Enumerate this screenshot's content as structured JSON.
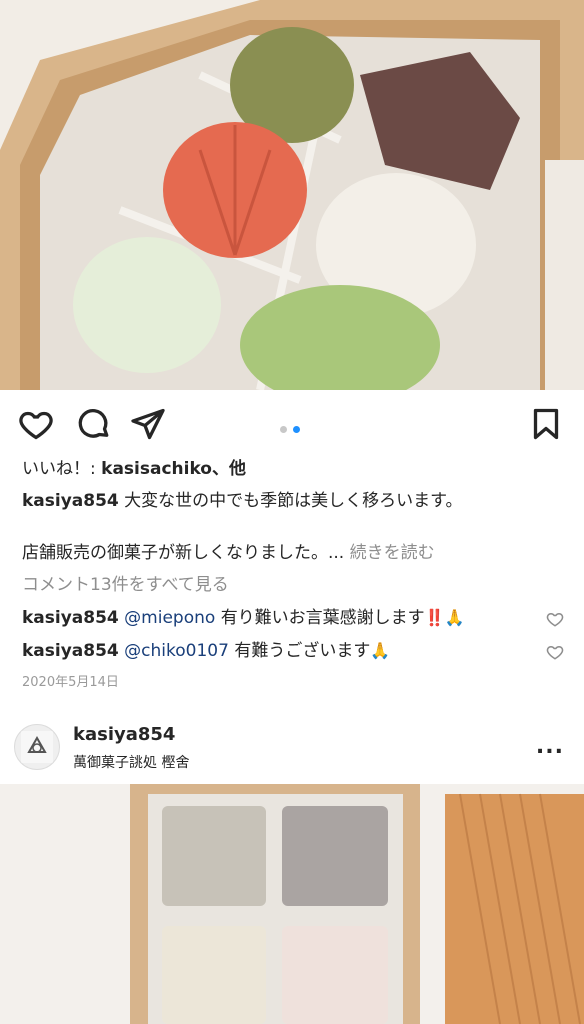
{
  "post1": {
    "likes_prefix": "いいね！: ",
    "likes_user": "kasisachiko",
    "likes_suffix": "、他",
    "caption_user": "kasiya854",
    "caption_text": "大変な世の中でも季節は美しく移ろいます。",
    "caption_line2": "店舗販売の御菓子が新しくなりました。...",
    "more_label": "続きを読む",
    "view_comments": "コメント13件をすべて見る",
    "comments": [
      {
        "user": "kasiya854",
        "mention": "@miepono",
        "text": "有り難いお言葉感謝します",
        "emoji": "‼️🙏"
      },
      {
        "user": "kasiya854",
        "mention": "@chiko0107",
        "text": "有難うございます",
        "emoji": "🙏"
      }
    ],
    "date": "2020年5月14日",
    "carousel": {
      "count": 2,
      "active_index": 1
    }
  },
  "post2": {
    "username": "kasiya854",
    "location": "萬御菓子誂処 樫舍",
    "more_icon": "..."
  },
  "colors": {
    "accent_dot": "#1e90ff",
    "mention": "#1a3f7a",
    "muted": "#8e8e8e"
  },
  "icons": [
    "heart-icon",
    "comment-icon",
    "share-icon",
    "bookmark-icon",
    "more-icon"
  ]
}
